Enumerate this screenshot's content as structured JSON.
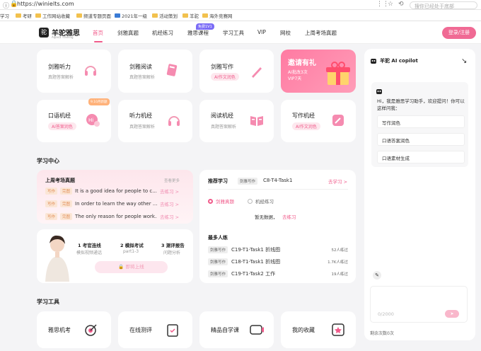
{
  "browser": {
    "url": "https://winielts.com",
    "search_placeholder": "搜你已经处于底部",
    "bookmarks": [
      "学习",
      "考研",
      "工作网站收藏",
      "频道专题页面",
      "2021年一级",
      "活动策划",
      "羊驼",
      "海外竞赛网"
    ]
  },
  "nav": {
    "logo_icon": "驼",
    "logo_title": "羊驼雅思",
    "logo_sub": "Alpaca Training",
    "items": [
      "首页",
      "剑雅真题",
      "机经练习",
      "雅思课程",
      "学习工具",
      "VIP",
      "网校",
      "上周考场真题"
    ],
    "free_tag": "免费1V1",
    "login": "登录/注册"
  },
  "cards": [
    {
      "title": "剑雅听力",
      "sub": "真题答案解析",
      "icon": "headphones-icon"
    },
    {
      "title": "剑雅阅读",
      "sub": "真题答案解析",
      "icon": "book-icon"
    },
    {
      "title": "剑雅写作",
      "sub": "AI作文润色",
      "icon": "pen-icon"
    },
    {
      "title": "口语机经",
      "sub": "AI答案润色",
      "icon": "chat-hi-icon",
      "badge": "9.10月新题"
    },
    {
      "title": "听力机经",
      "sub": "真题答案解析",
      "icon": "headphones-icon"
    },
    {
      "title": "阅读机经",
      "sub": "真题答案解析",
      "icon": "open-book-icon"
    },
    {
      "title": "写作机经",
      "sub": "AI作文润色",
      "icon": "edit-icon"
    }
  ],
  "invite": {
    "title": "邀请有礼",
    "line1": "AI批改3次",
    "line2": "VIP7天"
  },
  "study_center": {
    "title": "学习中心",
    "recent": {
      "title": "上周考场真题",
      "more": "查看更多",
      "rows": [
        {
          "tag1": "写作",
          "tag2": "完图",
          "text": "It is a good idea for people to c...",
          "go": "去练习"
        },
        {
          "tag1": "写作",
          "tag2": "完图",
          "text": "In order to learn the way other ...",
          "go": "去练习"
        },
        {
          "tag1": "写作",
          "tag2": "完图",
          "text": "The only reason for people work...",
          "go": "去练习"
        }
      ]
    },
    "mock": {
      "steps": [
        {
          "n": "1 考官连线",
          "d": "模拟视频通话"
        },
        {
          "n": "2 模拟考试",
          "d": "part1-3"
        },
        {
          "n": "3 测评报告",
          "d": "问题分析"
        }
      ],
      "button": "即将上线"
    },
    "recommend": {
      "title": "推荐学习",
      "tag": "剑雅写作",
      "task": "C8-T4-Task1",
      "go": "去学习",
      "radio1": "剑雅真题",
      "radio2": "机经练习",
      "empty": "暂无数据，",
      "empty_go": "去练习",
      "most_title": "最多人练",
      "most": [
        {
          "tag": "剑雅写作",
          "text": "C19-T1-Task1 折线图",
          "count": "52人练过"
        },
        {
          "tag": "剑雅写作",
          "text": "C18-T1-Task1 折线图",
          "count": "1.7K人练过"
        },
        {
          "tag": "剑雅写作",
          "text": "C19-T1-Task2 工作",
          "count": "19人练过"
        }
      ]
    }
  },
  "tools": {
    "title": "学习工具",
    "items": [
      {
        "label": "雅思机考",
        "icon": "target-icon"
      },
      {
        "label": "在线测评",
        "icon": "clipboard-icon"
      },
      {
        "label": "精品自学课",
        "icon": "video-icon"
      },
      {
        "label": "我的收藏",
        "icon": "star-box-icon"
      }
    ]
  },
  "copilot": {
    "title": "羊驼 AI copilot",
    "greeting": "Hi，我是雅思学习助手，欢迎提问！你可以这样问我：",
    "suggestions": [
      "写作润色",
      "口语答案润色",
      "口语素材生成"
    ],
    "counter": "0/2000",
    "remaining": "剩余次数0次"
  },
  "colors": {
    "accent": "#f05a8a",
    "login": "#f06a94",
    "purple_tag": "#7b6cf6"
  }
}
